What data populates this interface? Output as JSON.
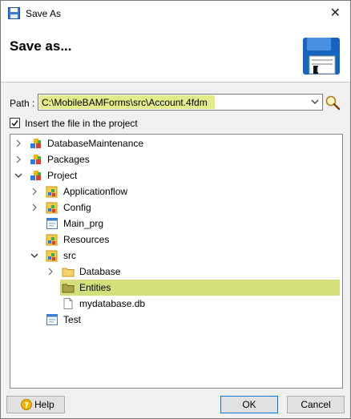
{
  "window": {
    "title": "Save As",
    "close_glyph": "✕"
  },
  "header": {
    "title": "Save as...",
    "icon": "floppy-disk-icon"
  },
  "path": {
    "label": "Path :",
    "value": "C:\\MobileBAMForms\\src\\Account.4fdm"
  },
  "insert": {
    "checked": true,
    "label": "Insert the file in the project"
  },
  "tree": {
    "nodes": [
      {
        "label": "DatabaseMaintenance",
        "expander": "collapsed",
        "icon": "project-blocks-icon"
      },
      {
        "label": "Packages",
        "expander": "collapsed",
        "icon": "project-blocks-icon"
      },
      {
        "label": "Project",
        "expander": "expanded",
        "icon": "project-blocks-icon"
      },
      {
        "label": "Applicationflow",
        "expander": "collapsed",
        "icon": "folder-blocks-icon"
      },
      {
        "label": "Config",
        "expander": "collapsed",
        "icon": "folder-blocks-icon"
      },
      {
        "label": "Main_prg",
        "expander": "none",
        "icon": "program-file-icon"
      },
      {
        "label": "Resources",
        "expander": "none",
        "icon": "folder-blocks-icon"
      },
      {
        "label": "src",
        "expander": "expanded",
        "icon": "folder-blocks-icon"
      },
      {
        "label": "Database",
        "expander": "collapsed",
        "icon": "folder-icon"
      },
      {
        "label": "Entities",
        "expander": "none",
        "icon": "folder-icon",
        "selected": true
      },
      {
        "label": "mydatabase.db",
        "expander": "none",
        "icon": "file-icon"
      },
      {
        "label": "Test",
        "expander": "none",
        "icon": "program-file-icon"
      }
    ]
  },
  "buttons": {
    "help": "Help",
    "ok": "OK",
    "cancel": "Cancel"
  },
  "colors": {
    "highlight": "#e2ec8a",
    "selection": "#d4df7a",
    "accent": "#0078d7"
  }
}
